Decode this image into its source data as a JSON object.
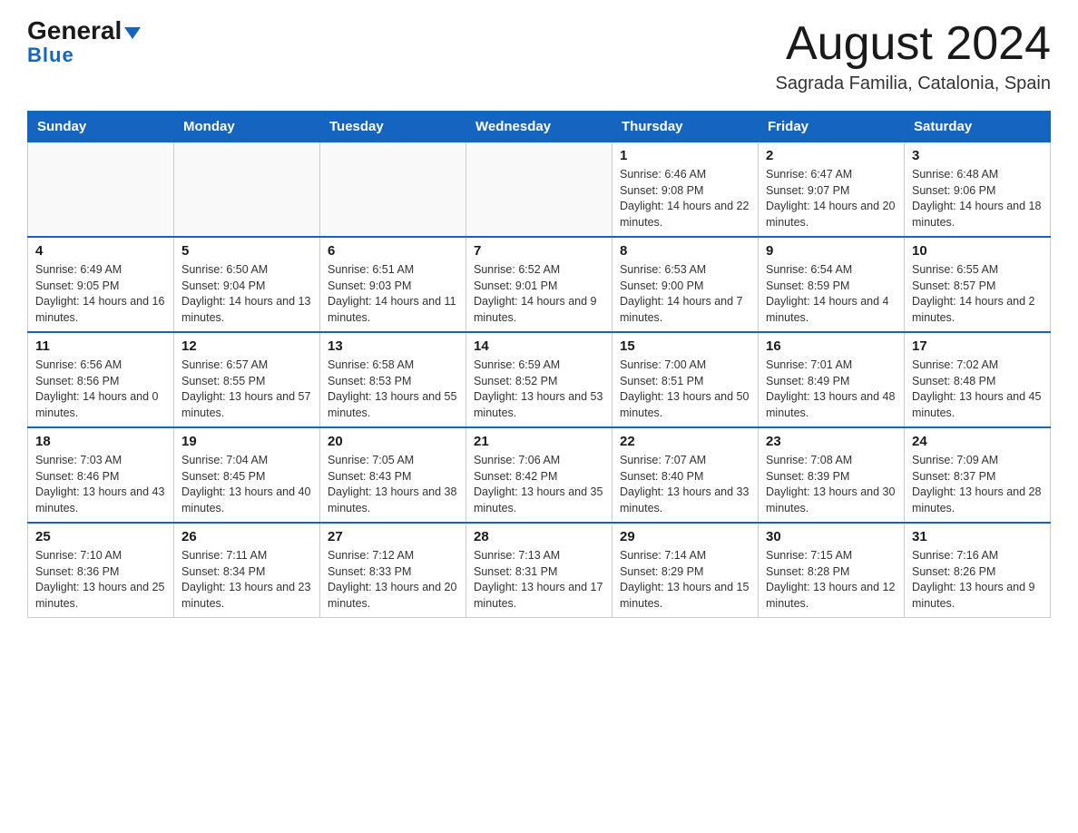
{
  "logo": {
    "text_general": "General",
    "text_blue": "Blue"
  },
  "title": "August 2024",
  "subtitle": "Sagrada Familia, Catalonia, Spain",
  "days_of_week": [
    "Sunday",
    "Monday",
    "Tuesday",
    "Wednesday",
    "Thursday",
    "Friday",
    "Saturday"
  ],
  "weeks": [
    [
      {
        "day": "",
        "info": ""
      },
      {
        "day": "",
        "info": ""
      },
      {
        "day": "",
        "info": ""
      },
      {
        "day": "",
        "info": ""
      },
      {
        "day": "1",
        "info": "Sunrise: 6:46 AM\nSunset: 9:08 PM\nDaylight: 14 hours and 22 minutes."
      },
      {
        "day": "2",
        "info": "Sunrise: 6:47 AM\nSunset: 9:07 PM\nDaylight: 14 hours and 20 minutes."
      },
      {
        "day": "3",
        "info": "Sunrise: 6:48 AM\nSunset: 9:06 PM\nDaylight: 14 hours and 18 minutes."
      }
    ],
    [
      {
        "day": "4",
        "info": "Sunrise: 6:49 AM\nSunset: 9:05 PM\nDaylight: 14 hours and 16 minutes."
      },
      {
        "day": "5",
        "info": "Sunrise: 6:50 AM\nSunset: 9:04 PM\nDaylight: 14 hours and 13 minutes."
      },
      {
        "day": "6",
        "info": "Sunrise: 6:51 AM\nSunset: 9:03 PM\nDaylight: 14 hours and 11 minutes."
      },
      {
        "day": "7",
        "info": "Sunrise: 6:52 AM\nSunset: 9:01 PM\nDaylight: 14 hours and 9 minutes."
      },
      {
        "day": "8",
        "info": "Sunrise: 6:53 AM\nSunset: 9:00 PM\nDaylight: 14 hours and 7 minutes."
      },
      {
        "day": "9",
        "info": "Sunrise: 6:54 AM\nSunset: 8:59 PM\nDaylight: 14 hours and 4 minutes."
      },
      {
        "day": "10",
        "info": "Sunrise: 6:55 AM\nSunset: 8:57 PM\nDaylight: 14 hours and 2 minutes."
      }
    ],
    [
      {
        "day": "11",
        "info": "Sunrise: 6:56 AM\nSunset: 8:56 PM\nDaylight: 14 hours and 0 minutes."
      },
      {
        "day": "12",
        "info": "Sunrise: 6:57 AM\nSunset: 8:55 PM\nDaylight: 13 hours and 57 minutes."
      },
      {
        "day": "13",
        "info": "Sunrise: 6:58 AM\nSunset: 8:53 PM\nDaylight: 13 hours and 55 minutes."
      },
      {
        "day": "14",
        "info": "Sunrise: 6:59 AM\nSunset: 8:52 PM\nDaylight: 13 hours and 53 minutes."
      },
      {
        "day": "15",
        "info": "Sunrise: 7:00 AM\nSunset: 8:51 PM\nDaylight: 13 hours and 50 minutes."
      },
      {
        "day": "16",
        "info": "Sunrise: 7:01 AM\nSunset: 8:49 PM\nDaylight: 13 hours and 48 minutes."
      },
      {
        "day": "17",
        "info": "Sunrise: 7:02 AM\nSunset: 8:48 PM\nDaylight: 13 hours and 45 minutes."
      }
    ],
    [
      {
        "day": "18",
        "info": "Sunrise: 7:03 AM\nSunset: 8:46 PM\nDaylight: 13 hours and 43 minutes."
      },
      {
        "day": "19",
        "info": "Sunrise: 7:04 AM\nSunset: 8:45 PM\nDaylight: 13 hours and 40 minutes."
      },
      {
        "day": "20",
        "info": "Sunrise: 7:05 AM\nSunset: 8:43 PM\nDaylight: 13 hours and 38 minutes."
      },
      {
        "day": "21",
        "info": "Sunrise: 7:06 AM\nSunset: 8:42 PM\nDaylight: 13 hours and 35 minutes."
      },
      {
        "day": "22",
        "info": "Sunrise: 7:07 AM\nSunset: 8:40 PM\nDaylight: 13 hours and 33 minutes."
      },
      {
        "day": "23",
        "info": "Sunrise: 7:08 AM\nSunset: 8:39 PM\nDaylight: 13 hours and 30 minutes."
      },
      {
        "day": "24",
        "info": "Sunrise: 7:09 AM\nSunset: 8:37 PM\nDaylight: 13 hours and 28 minutes."
      }
    ],
    [
      {
        "day": "25",
        "info": "Sunrise: 7:10 AM\nSunset: 8:36 PM\nDaylight: 13 hours and 25 minutes."
      },
      {
        "day": "26",
        "info": "Sunrise: 7:11 AM\nSunset: 8:34 PM\nDaylight: 13 hours and 23 minutes."
      },
      {
        "day": "27",
        "info": "Sunrise: 7:12 AM\nSunset: 8:33 PM\nDaylight: 13 hours and 20 minutes."
      },
      {
        "day": "28",
        "info": "Sunrise: 7:13 AM\nSunset: 8:31 PM\nDaylight: 13 hours and 17 minutes."
      },
      {
        "day": "29",
        "info": "Sunrise: 7:14 AM\nSunset: 8:29 PM\nDaylight: 13 hours and 15 minutes."
      },
      {
        "day": "30",
        "info": "Sunrise: 7:15 AM\nSunset: 8:28 PM\nDaylight: 13 hours and 12 minutes."
      },
      {
        "day": "31",
        "info": "Sunrise: 7:16 AM\nSunset: 8:26 PM\nDaylight: 13 hours and 9 minutes."
      }
    ]
  ]
}
